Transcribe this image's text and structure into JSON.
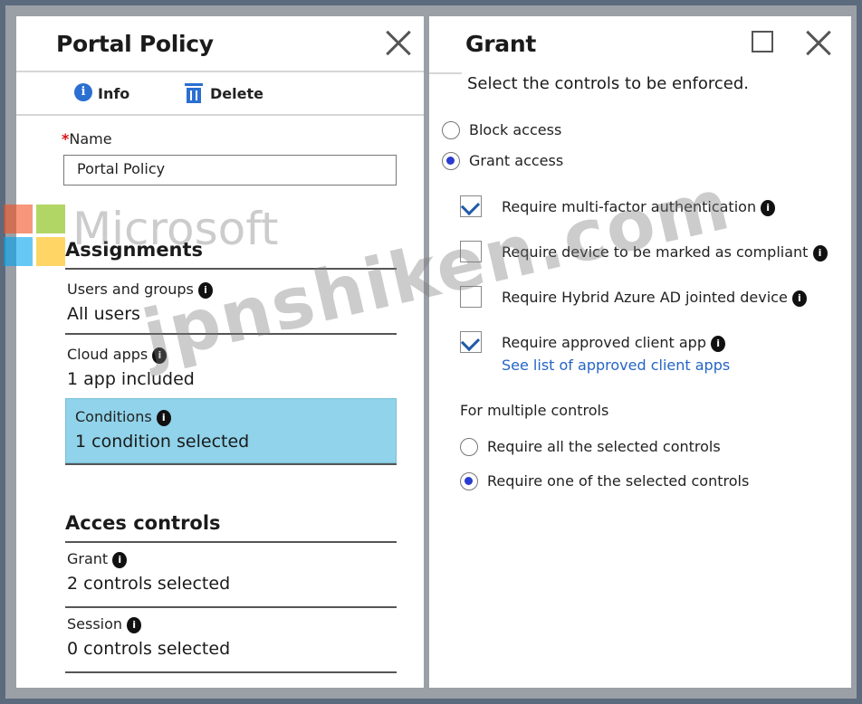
{
  "left_blade": {
    "title": "Portal Policy",
    "toolbar": {
      "info_label": "Info",
      "delete_label": "Delete"
    },
    "name_field": {
      "label": "Name",
      "required_marker": "*",
      "value": "Portal Policy"
    },
    "assignments": {
      "heading": "Assignments",
      "users_and_groups": {
        "label": "Users and groups",
        "value": "All users"
      },
      "cloud_apps": {
        "label": "Cloud apps",
        "value": "1 app included"
      },
      "conditions": {
        "label": "Conditions",
        "value": "1 condition selected"
      }
    },
    "access_controls": {
      "heading": "Acces controls",
      "grant": {
        "label": "Grant",
        "value": "2 controls selected"
      },
      "session": {
        "label": "Session",
        "value": "0 controls selected"
      }
    }
  },
  "right_blade": {
    "title": "Grant",
    "subtitle": "Select the controls to be enforced.",
    "access_options": [
      {
        "label": "Block access",
        "selected": false
      },
      {
        "label": "Grant access",
        "selected": true
      }
    ],
    "controls": [
      {
        "label": "Require multi-factor authentication",
        "checked": true
      },
      {
        "label": "Require device to be marked as compliant",
        "checked": false
      },
      {
        "label": "Require Hybrid Azure AD jointed device",
        "checked": false
      },
      {
        "label": "Require approved client app",
        "checked": true,
        "link": "See list of approved client apps"
      }
    ],
    "multiple_controls": {
      "heading": "For multiple controls",
      "options": [
        {
          "label": "Require all the selected controls",
          "selected": false
        },
        {
          "label": "Require one of the selected controls",
          "selected": true
        }
      ]
    }
  },
  "watermarks": {
    "brand": "Microsoft",
    "site": "jpnshiken.com"
  },
  "colors": {
    "selected_row": "#90d3ea",
    "radio_dot": "#2a3ccf",
    "link": "#2565c7",
    "toolbar_icon": "#2a6fd1"
  },
  "icons": {
    "info": "info-icon",
    "delete": "trash-icon",
    "close": "close-icon",
    "maximize": "maximize-icon",
    "tooltip": "info-circle-icon"
  }
}
